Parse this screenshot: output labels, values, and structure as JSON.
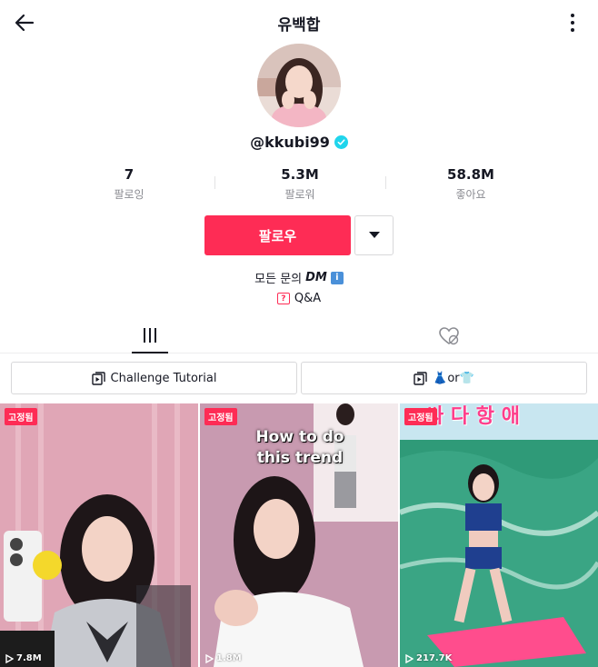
{
  "header": {
    "title": "유백합",
    "back_icon": "arrow-left-icon",
    "more_icon": "more-vertical-icon"
  },
  "profile": {
    "username": "@kkubi99",
    "verified_icon": "verified-badge-icon",
    "verified_color": "#20d5ec"
  },
  "stats": [
    {
      "value": "7",
      "label": "팔로잉"
    },
    {
      "value": "5.3M",
      "label": "팔로워"
    },
    {
      "value": "58.8M",
      "label": "좋아요"
    }
  ],
  "actions": {
    "follow_label": "팔로우",
    "follow_color": "#fe2c55",
    "dropdown_icon": "caret-down-icon"
  },
  "bio": {
    "text": "모든 문의",
    "dm": "DM",
    "emoji": "ℹ️"
  },
  "qa": {
    "label": "Q&A",
    "icon_text": "?"
  },
  "tabs": [
    {
      "name": "videos",
      "icon": "grid-icon",
      "active": true
    },
    {
      "name": "liked",
      "icon": "heart-hidden-icon",
      "active": false
    }
  ],
  "playlists": [
    {
      "label": "Challenge Tutorial",
      "icon": "playlist-icon"
    },
    {
      "label": "👗or👕",
      "icon": "playlist-icon"
    }
  ],
  "videos": [
    {
      "pinned": "고정됨",
      "views": "7.8M",
      "overlay": ""
    },
    {
      "pinned": "고정됨",
      "views": "1.8M",
      "overlay": "How to do\nthis trend"
    },
    {
      "pinned": "고정됨",
      "views": "217.7K",
      "overlay": "싸 다 항 애"
    }
  ]
}
